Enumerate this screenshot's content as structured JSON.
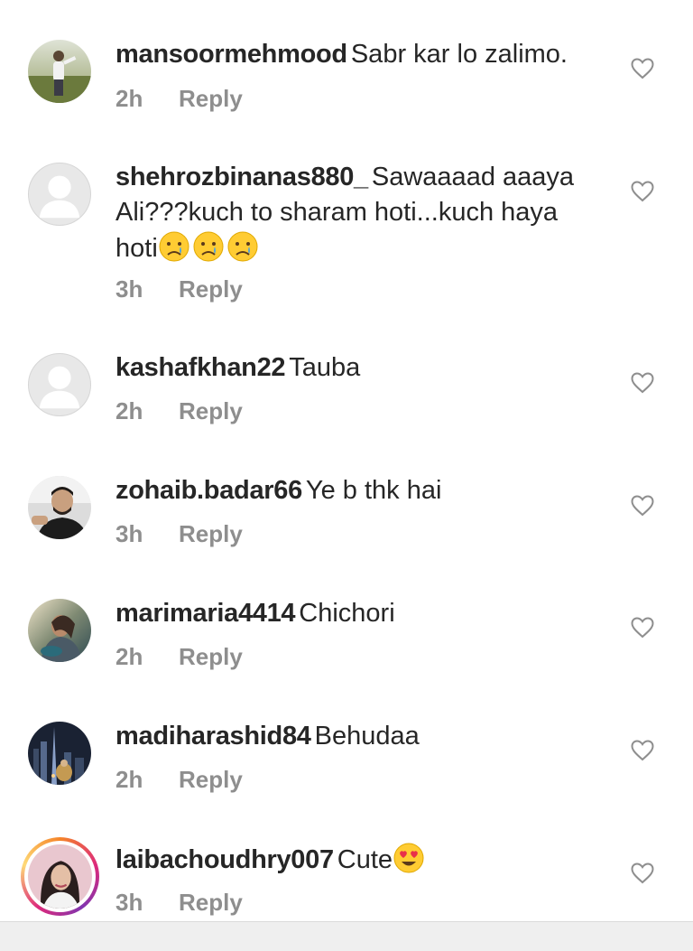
{
  "comments": [
    {
      "username": "mansoormehmood",
      "text": "Sabr kar lo zalimo.",
      "time": "2h",
      "reply": "Reply",
      "avatar": "photo-man-outdoors",
      "emojis": []
    },
    {
      "username": "shehrozbinanas880_",
      "text": "Sawaaaad aaaya Ali???kuch to sharam hoti...kuch haya hoti",
      "time": "3h",
      "reply": "Reply",
      "avatar": "default-avatar",
      "emojis": [
        "crying-face",
        "crying-face",
        "crying-face"
      ]
    },
    {
      "username": "kashafkhan22",
      "text": "Tauba",
      "time": "2h",
      "reply": "Reply",
      "avatar": "default-avatar",
      "emojis": []
    },
    {
      "username": "zohaib.badar66",
      "text": "Ye b thk hai",
      "time": "3h",
      "reply": "Reply",
      "avatar": "photo-man-portrait",
      "emojis": []
    },
    {
      "username": "marimaria4414",
      "text": "Chichori",
      "time": "2h",
      "reply": "Reply",
      "avatar": "photo-person-pose",
      "emojis": []
    },
    {
      "username": "madiharashid84",
      "text": "Behudaa",
      "time": "2h",
      "reply": "Reply",
      "avatar": "photo-city-night",
      "emojis": []
    },
    {
      "username": "laibachoudhry007",
      "text": "Cute",
      "time": "3h",
      "reply": "Reply",
      "avatar": "photo-woman-story",
      "emojis": [
        "heart-eyes-face"
      ]
    }
  ],
  "colors": {
    "text": "#262626",
    "meta": "#8e8e8e",
    "heart_outline": "#8e8e8e",
    "bottom_bar": "#efefef"
  },
  "icons": {
    "like": "heart-outline-icon"
  }
}
